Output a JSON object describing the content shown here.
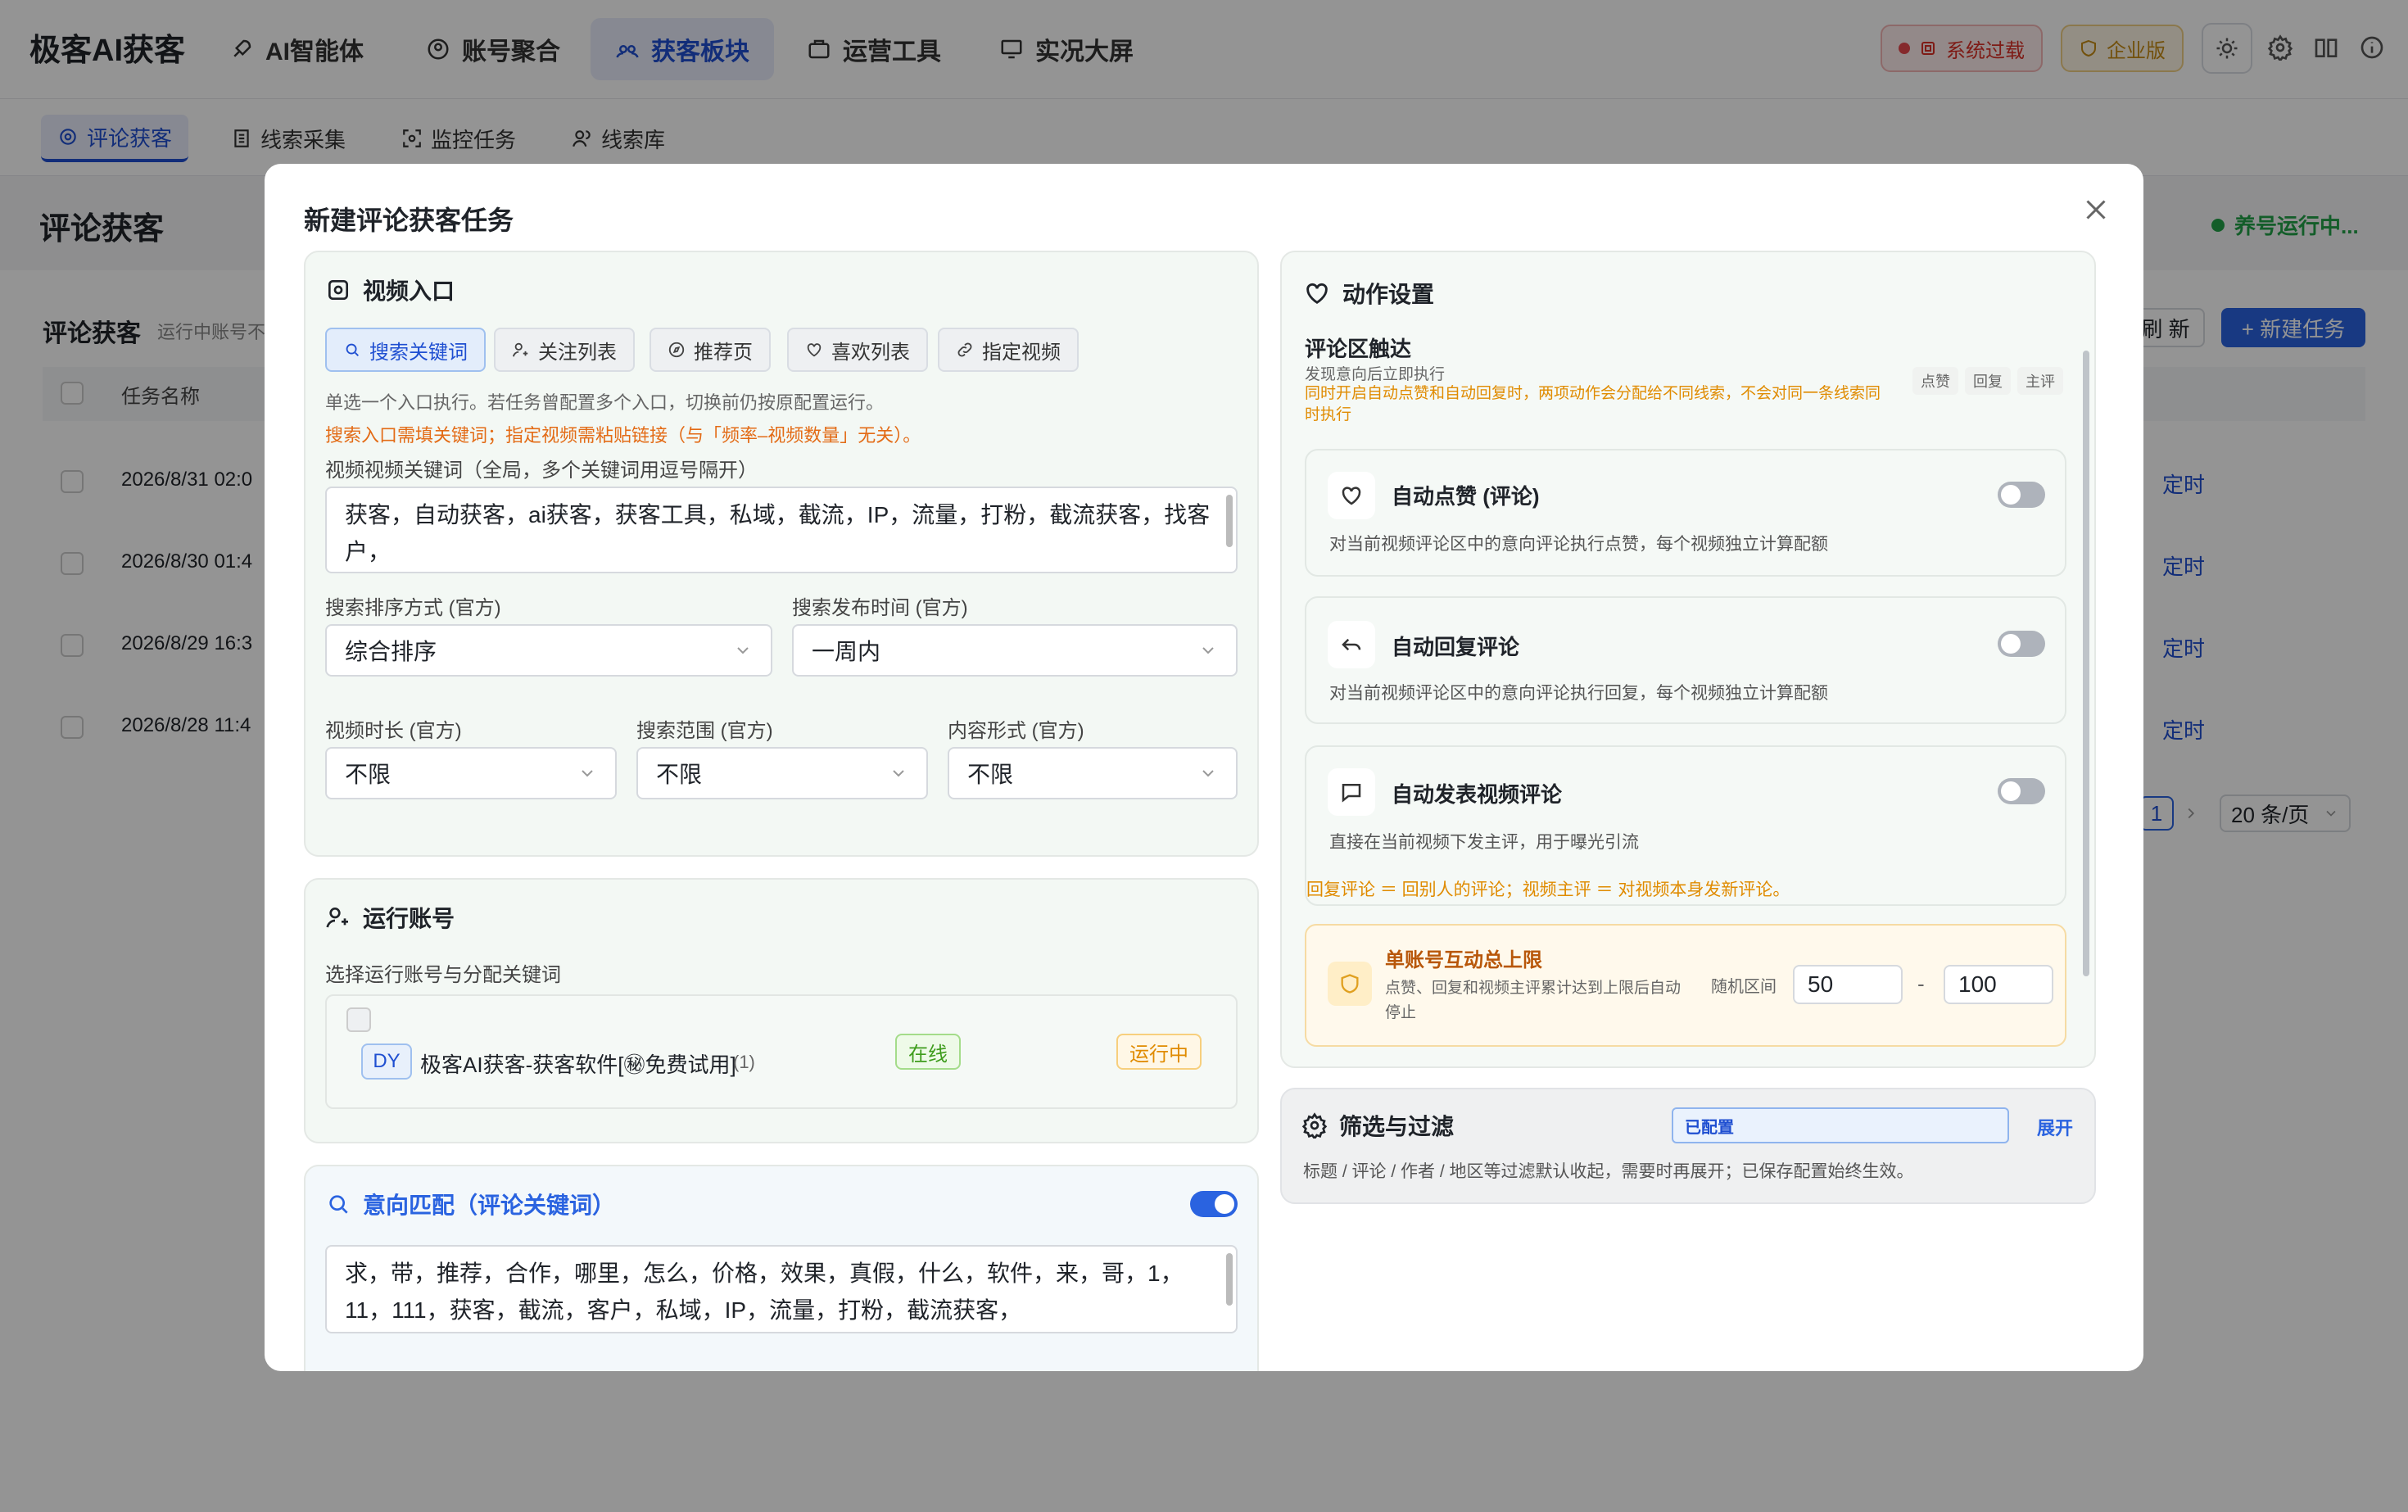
{
  "app": {
    "logo": "极客AI获客"
  },
  "nav": {
    "items": [
      {
        "label": "AI智能体",
        "icon": "rocket-icon"
      },
      {
        "label": "账号聚合",
        "icon": "user-circle-icon"
      },
      {
        "label": "获客板块",
        "icon": "people-icon",
        "active": true
      },
      {
        "label": "运营工具",
        "icon": "briefcase-icon"
      },
      {
        "label": "实况大屏",
        "icon": "monitor-icon"
      }
    ],
    "overload_label": "系统过载",
    "enterprise_label": "企业版"
  },
  "subnav": {
    "tabs": [
      {
        "label": "评论获客",
        "active": true
      },
      {
        "label": "线索采集"
      },
      {
        "label": "监控任务"
      },
      {
        "label": "线索库"
      }
    ]
  },
  "page": {
    "title": "评论获客",
    "running_status": "养号运行中...",
    "section_title": "评论获客",
    "section_sub": "运行中账号不",
    "refresh_label": "刷 新",
    "new_task_label": "+ 新建任务",
    "col_task_name": "任务名称",
    "rows": [
      {
        "date": "2026/8/31 02:0",
        "mode": "定时"
      },
      {
        "date": "2026/8/30 01:4",
        "mode": "定时"
      },
      {
        "date": "2026/8/29 16:3",
        "mode": "定时"
      },
      {
        "date": "2026/8/28 11:4",
        "mode": "定时"
      }
    ],
    "current_page": "1",
    "page_size": "20 条/页"
  },
  "modal": {
    "title": "新建评论获客任务",
    "video_entry": {
      "title": "视频入口",
      "chips": [
        {
          "label": "搜索关键词",
          "icon": "search-icon",
          "active": true
        },
        {
          "label": "关注列表",
          "icon": "user-add-icon"
        },
        {
          "label": "推荐页",
          "icon": "compass-icon"
        },
        {
          "label": "喜欢列表",
          "icon": "heart-icon"
        },
        {
          "label": "指定视频",
          "icon": "link-icon"
        }
      ],
      "note1": "单选一个入口执行。若任务曾配置多个入口，切换前仍按原配置运行。",
      "note2": "搜索入口需填关键词；指定视频需粘贴链接（与「频率–视频数量」无关）。",
      "keywords_label": "视频视频关键词（全局，多个关键词用逗号隔开）",
      "keywords_value": "获客，自动获客，ai获客，获客工具，私域，截流，IP，流量，打粉，截流获客，找客户，",
      "sort_label": "搜索排序方式 (官方)",
      "sort_value": "综合排序",
      "time_label": "搜索发布时间 (官方)",
      "time_value": "一周内",
      "duration_label": "视频时长 (官方)",
      "duration_value": "不限",
      "range_label": "搜索范围 (官方)",
      "range_value": "不限",
      "content_label": "内容形式 (官方)",
      "content_value": "不限"
    },
    "accounts": {
      "title": "运行账号",
      "subtitle": "选择运行账号与分配关键词",
      "platform": "DY",
      "name": "极客AI获客-获客软件[㊙免费试用]",
      "count": "(1)",
      "online": "在线",
      "running": "运行中"
    },
    "intent": {
      "title": "意向匹配（评论关键词）",
      "keywords_value": "求，带，推荐，合作，哪里，怎么，价格，效果，真假，什么，软件，来，哥，1，11，111，获客，截流，客户，私域，IP，流量，打粉，截流获客，"
    },
    "actions": {
      "title": "动作设置",
      "comment_title": "评论区触达",
      "comment_sub": "发现意向后立即执行",
      "comment_warn": "同时开启自动点赞和自动回复时，两项动作会分配给不同线索，不会对同一条线索同时执行",
      "tags": [
        "点赞",
        "回复",
        "主评"
      ],
      "items": [
        {
          "title": "自动点赞 (评论)",
          "desc": "对当前视频评论区中的意向评论执行点赞，每个视频独立计算配额",
          "icon": "heart-icon"
        },
        {
          "title": "自动回复评论",
          "desc": "对当前视频评论区中的意向评论执行回复，每个视频独立计算配额",
          "icon": "reply-icon"
        },
        {
          "title": "自动发表视频评论",
          "desc": "直接在当前视频下发主评，用于曝光引流",
          "icon": "comment-icon"
        }
      ],
      "footnote": "回复评论 ＝ 回别人的评论；视频主评 ＝ 对视频本身发新评论。",
      "limit_title": "单账号互动总上限",
      "limit_desc": "点赞、回复和视频主评累计达到上限后自动停止",
      "range_label": "随机区间",
      "min": "50",
      "dash": "-",
      "max": "100"
    },
    "filter": {
      "title": "筛选与过滤",
      "badge": "已配置",
      "expand": "展开",
      "desc": "标题 / 评论 / 作者 / 地区等过滤默认收起，需要时再展开；已保存配置始终生效。"
    }
  }
}
